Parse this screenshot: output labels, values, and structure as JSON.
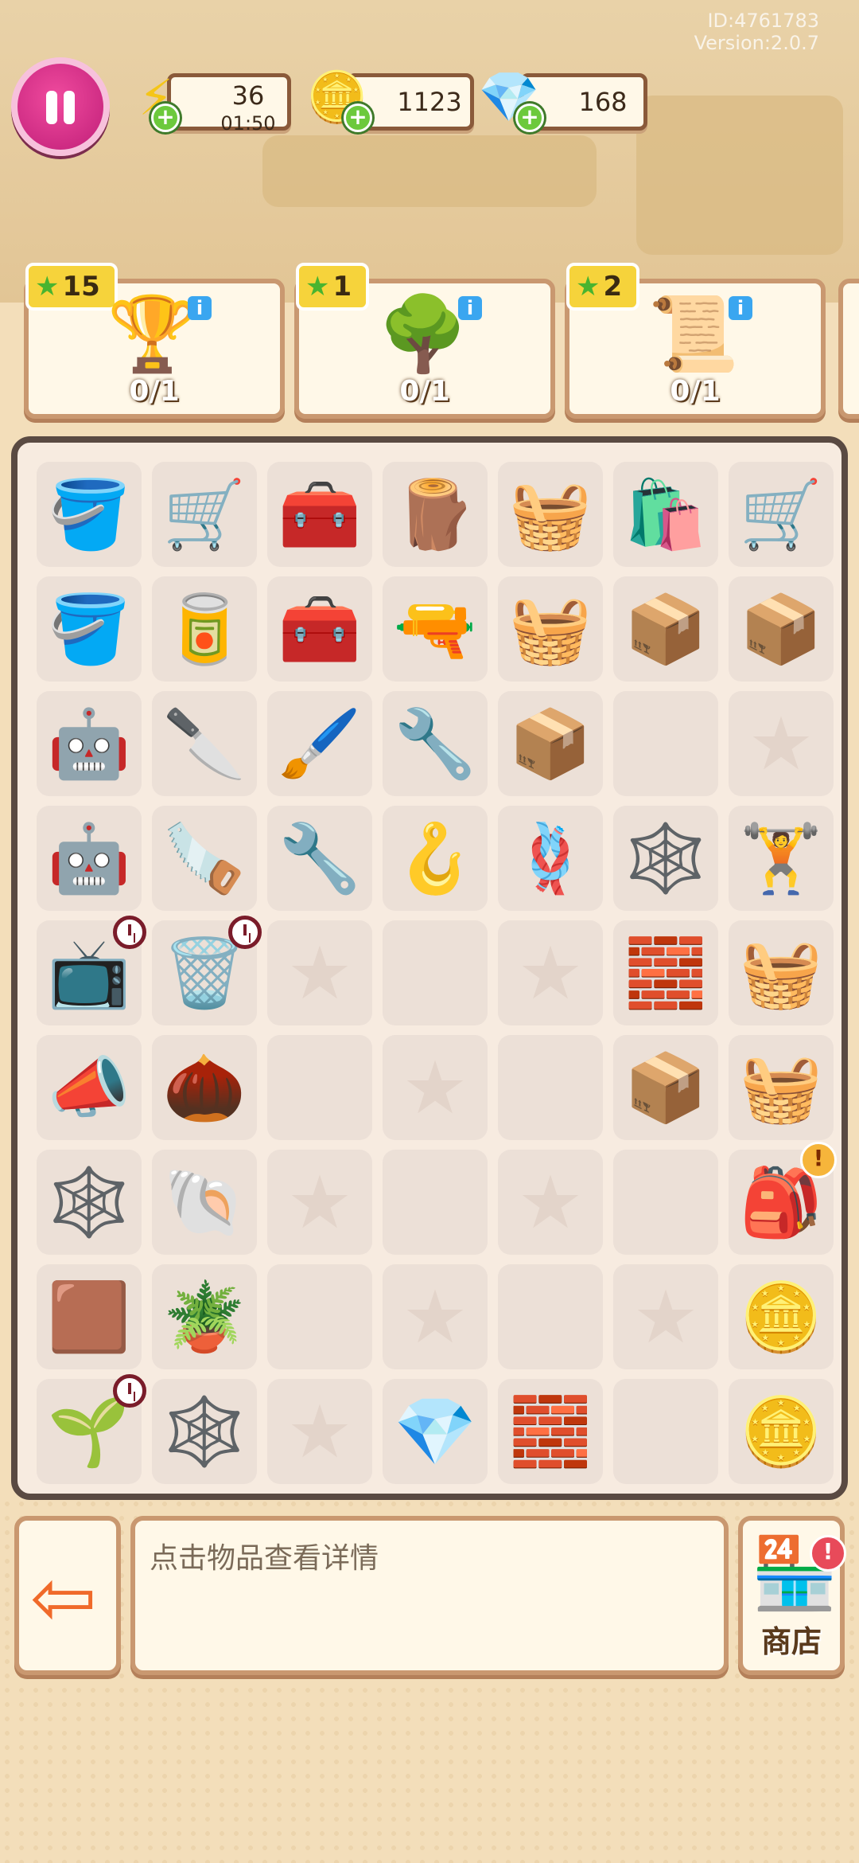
{
  "info": {
    "id_text": "ID:4761783",
    "version_text": "Version:2.0.7"
  },
  "resources": {
    "energy": {
      "value": "36",
      "timer": "01:50",
      "icon": "lightning-icon"
    },
    "coins": {
      "value": "1123",
      "icon": "coin-icon"
    },
    "gems": {
      "value": "168",
      "icon": "gem-icon"
    }
  },
  "quests": [
    {
      "stars": "15",
      "progress": "0/1",
      "icon": "trophy-icon"
    },
    {
      "stars": "1",
      "progress": "0/1",
      "icon": "tree-icon"
    },
    {
      "stars": "2",
      "progress": "0/1",
      "icon": "scroll-icon"
    }
  ],
  "board": {
    "rows": [
      [
        {
          "item": "bucket-with-tools",
          "glyph": "🪣"
        },
        {
          "item": "cart-with-tools",
          "glyph": "🛒"
        },
        {
          "item": "green-toolbox",
          "glyph": "🧰"
        },
        {
          "item": "stump",
          "glyph": "🪵"
        },
        {
          "item": "wicker-basket",
          "glyph": "🧺"
        },
        {
          "item": "paper-bag",
          "glyph": "🛍️"
        },
        {
          "item": "shopping-cart",
          "glyph": "🛒"
        }
      ],
      [
        {
          "item": "pink-bucket",
          "glyph": "🪣"
        },
        {
          "item": "paint-bucket",
          "glyph": "🥫"
        },
        {
          "item": "open-toolbox",
          "glyph": "🧰"
        },
        {
          "item": "drill",
          "glyph": "🔫"
        },
        {
          "item": "woven-basket",
          "glyph": "🧺"
        },
        {
          "item": "cardboard-pieces",
          "glyph": "📦"
        },
        {
          "item": "flat-box",
          "glyph": "📦"
        }
      ],
      [
        {
          "item": "robot-vacuum",
          "glyph": "🤖"
        },
        {
          "item": "box-cutter",
          "glyph": "🔪"
        },
        {
          "item": "paint-roller",
          "glyph": "🖌️"
        },
        {
          "item": "wrench",
          "glyph": "🔧"
        },
        {
          "item": "small-box",
          "glyph": "📦"
        },
        {
          "item": "empty",
          "glyph": ""
        },
        {
          "item": "star-slot",
          "glyph": "★"
        }
      ],
      [
        {
          "item": "blue-robot-vacuum",
          "glyph": "🤖"
        },
        {
          "item": "hacksaw",
          "glyph": "🪚"
        },
        {
          "item": "hex-key",
          "glyph": "🔧"
        },
        {
          "item": "pipe-hook",
          "glyph": "🪝"
        },
        {
          "item": "rope-coil",
          "glyph": "🪢"
        },
        {
          "item": "cpu-chip-web",
          "glyph": "🕸️"
        },
        {
          "item": "dumbbell",
          "glyph": "🏋️"
        }
      ],
      [
        {
          "item": "old-tv",
          "glyph": "📺",
          "timer": true
        },
        {
          "item": "garbage-bag",
          "glyph": "🗑️",
          "timer": true
        },
        {
          "item": "star-slot",
          "glyph": "★"
        },
        {
          "item": "empty",
          "glyph": ""
        },
        {
          "item": "star-slot",
          "glyph": "★"
        },
        {
          "item": "blue-tiles",
          "glyph": "🧱"
        },
        {
          "item": "open-basket",
          "glyph": "🧺"
        }
      ],
      [
        {
          "item": "megaphone",
          "glyph": "📣"
        },
        {
          "item": "seed-bag",
          "glyph": "🌰"
        },
        {
          "item": "empty",
          "glyph": ""
        },
        {
          "item": "star-slot",
          "glyph": "★"
        },
        {
          "item": "empty",
          "glyph": ""
        },
        {
          "item": "rope-box",
          "glyph": "📦"
        },
        {
          "item": "basket-tools",
          "glyph": "🧺"
        }
      ],
      [
        {
          "item": "cpu-chip-web",
          "glyph": "🕸️"
        },
        {
          "item": "snail-shell",
          "glyph": "🐚"
        },
        {
          "item": "star-slot",
          "glyph": "★"
        },
        {
          "item": "empty",
          "glyph": ""
        },
        {
          "item": "star-slot",
          "glyph": "★"
        },
        {
          "item": "empty",
          "glyph": ""
        },
        {
          "item": "pink-backpack",
          "glyph": "🎒",
          "alert": true
        }
      ],
      [
        {
          "item": "sandbags",
          "glyph": "🟫"
        },
        {
          "item": "potted-sprout",
          "glyph": "🪴"
        },
        {
          "item": "empty",
          "glyph": ""
        },
        {
          "item": "star-slot",
          "glyph": "★"
        },
        {
          "item": "empty",
          "glyph": ""
        },
        {
          "item": "star-slot",
          "glyph": "★"
        },
        {
          "item": "coin-stack",
          "glyph": "🪙"
        }
      ],
      [
        {
          "item": "sprout-pot",
          "glyph": "🌱",
          "timer": true
        },
        {
          "item": "cpu-chip-web",
          "glyph": "🕸️"
        },
        {
          "item": "star-slot",
          "glyph": "★"
        },
        {
          "item": "pink-gem",
          "glyph": "💎"
        },
        {
          "item": "pink-brick",
          "glyph": "🧱"
        },
        {
          "item": "empty",
          "glyph": ""
        },
        {
          "item": "coin-pile",
          "glyph": "🪙"
        }
      ]
    ]
  },
  "bottom": {
    "exit_icon": "exit-icon",
    "hint": "点击物品查看详情",
    "shop_label": "商店",
    "shop_icon": "shop-icon"
  },
  "colors": {
    "accent_pink": "#d8237f",
    "panel_border": "#c99870",
    "board_border": "#5a4a42",
    "star_tag": "#f6d33b"
  }
}
